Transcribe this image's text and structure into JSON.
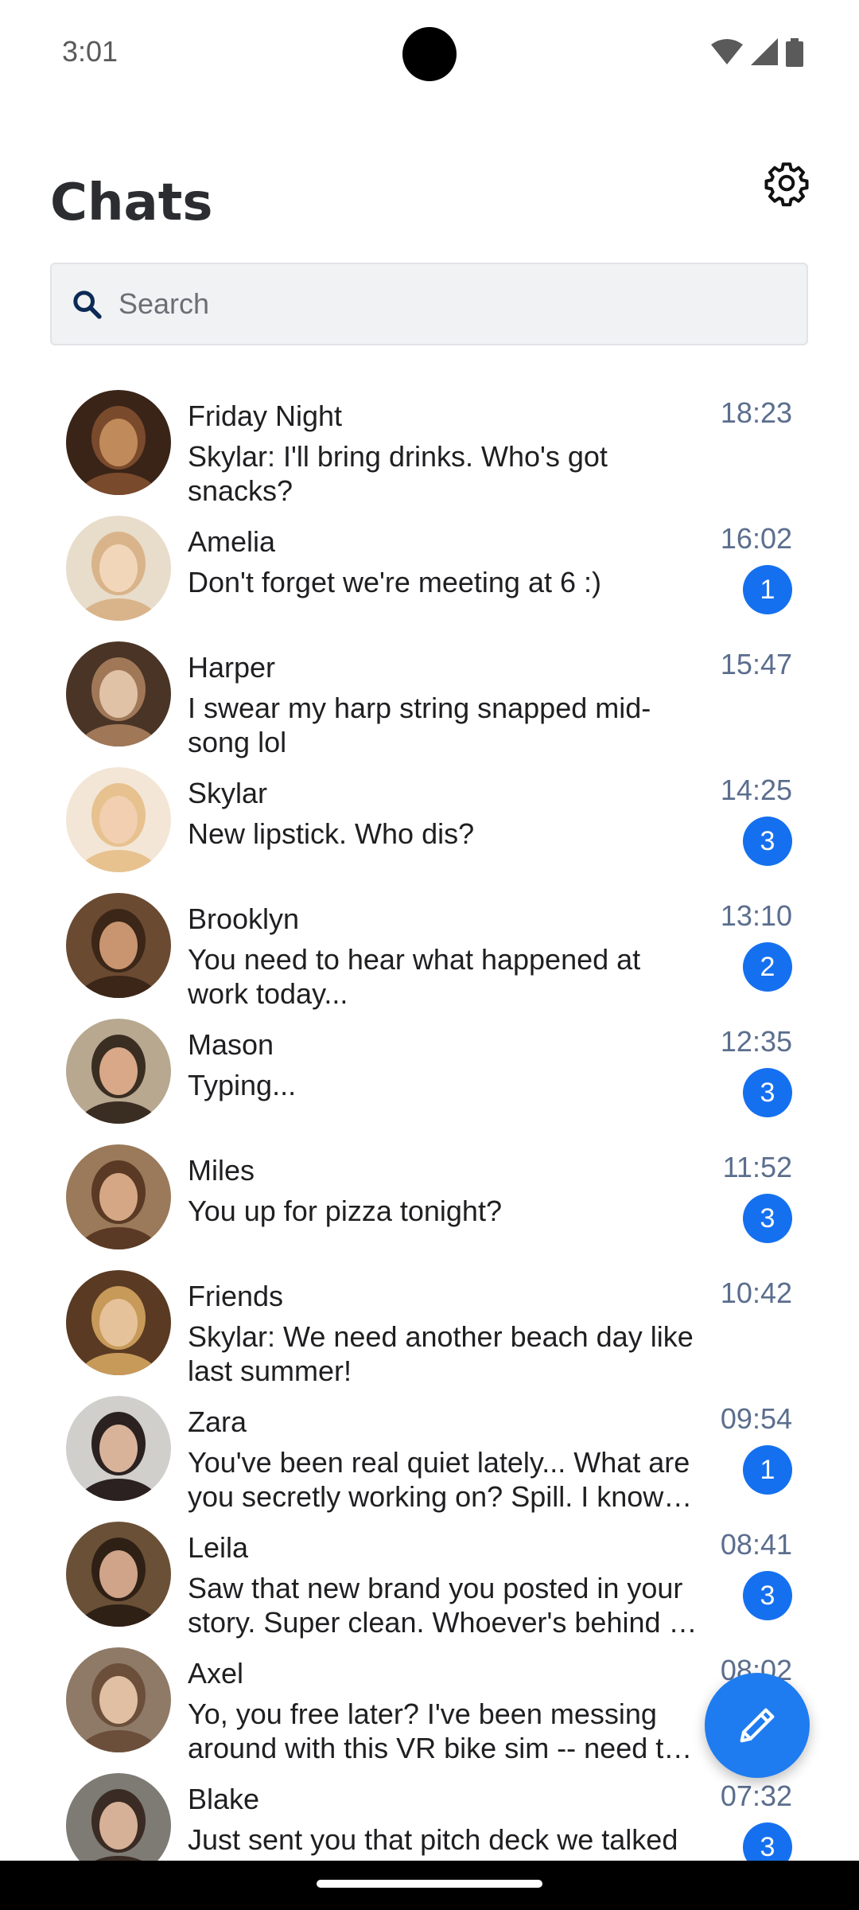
{
  "status_bar": {
    "time": "3:01"
  },
  "header": {
    "title": "Chats"
  },
  "search": {
    "placeholder": "Search",
    "value": ""
  },
  "colors": {
    "accent": "#1570ef",
    "fab": "#1f7cf0",
    "time_text": "#5b6e8e"
  },
  "chats": [
    {
      "name": "Friday Night",
      "preview": "Skylar: I'll bring drinks. Who's got snacks?",
      "time": "18:23",
      "unread": "",
      "avatar": "group-bar-avatar"
    },
    {
      "name": "Amelia",
      "preview": "Don't forget we're meeting at 6 :)",
      "time": "16:02",
      "unread": "1",
      "avatar": "blonde-woman-avatar"
    },
    {
      "name": "Harper",
      "preview": "I swear my harp string snapped mid-song lol",
      "time": "15:47",
      "unread": "",
      "avatar": "harp-woman-avatar"
    },
    {
      "name": "Skylar",
      "preview": "New lipstick. Who dis?",
      "time": "14:25",
      "unread": "3",
      "avatar": "lollipop-woman-avatar"
    },
    {
      "name": "Brooklyn",
      "preview": "You need to hear what happened at work today...",
      "time": "13:10",
      "unread": "2",
      "avatar": "two-women-avatar"
    },
    {
      "name": "Mason",
      "preview": "Typing...",
      "time": "12:35",
      "unread": "3",
      "avatar": "smiling-man-avatar"
    },
    {
      "name": "Miles",
      "preview": "You up for pizza tonight?",
      "time": "11:52",
      "unread": "3",
      "avatar": "bearded-man-avatar"
    },
    {
      "name": "Friends",
      "preview": "Skylar: We need another beach day like last summer!",
      "time": "10:42",
      "unread": "",
      "avatar": "friends-group-avatar"
    },
    {
      "name": "Zara",
      "preview": "You've been real quiet lately... What are you secretly working on? Spill. I know you're up to something",
      "time": "09:54",
      "unread": "1",
      "avatar": "dark-hair-woman-avatar"
    },
    {
      "name": "Leila",
      "preview": "Saw that new brand you posted in your story. Super clean. Whoever's behind it knows what they're doing",
      "time": "08:41",
      "unread": "3",
      "avatar": "leila-avatar"
    },
    {
      "name": "Axel",
      "preview": "Yo, you free later? I've been messing around with this VR bike sim -- need to show you",
      "time": "08:02",
      "unread": "",
      "avatar": "glasses-man-avatar"
    },
    {
      "name": "Blake",
      "preview": "Just sent you that pitch deck we talked about",
      "time": "07:32",
      "unread": "3",
      "avatar": "blake-avatar"
    }
  ]
}
